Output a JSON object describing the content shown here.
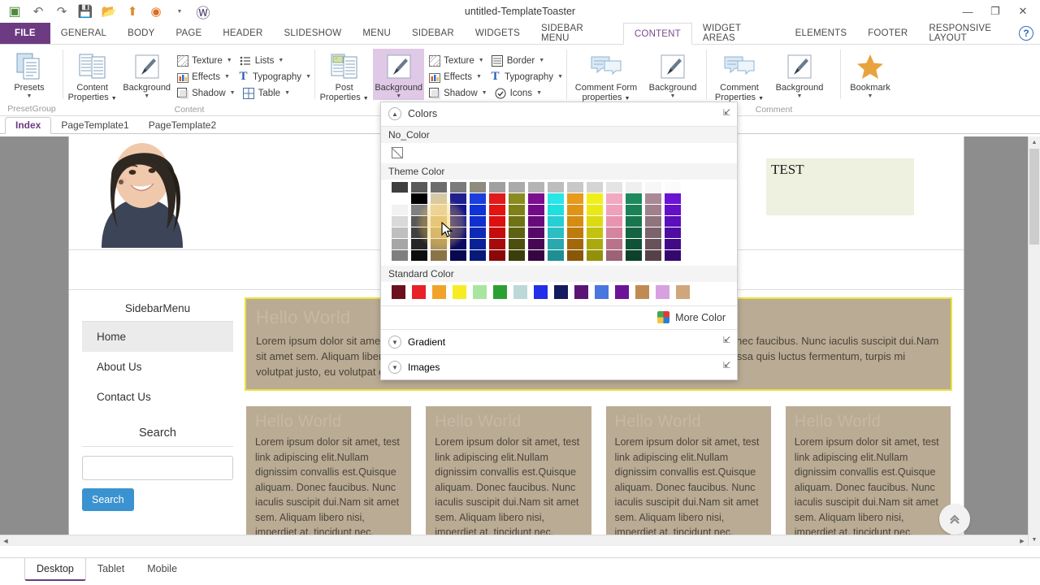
{
  "window": {
    "title": "untitled-TemplateToaster",
    "minimize": "—",
    "restore": "❐",
    "close": "✕",
    "help": "?"
  },
  "quick_access": [
    {
      "name": "app-logo-icon",
      "glyph": "▣"
    },
    {
      "name": "undo-icon",
      "glyph": "↶"
    },
    {
      "name": "redo-icon",
      "glyph": "↷"
    },
    {
      "name": "save-icon",
      "glyph": "ὋE"
    },
    {
      "name": "open-icon",
      "glyph": "Ὄ2"
    },
    {
      "name": "export-icon",
      "glyph": "⬆"
    },
    {
      "name": "browser-preview-icon",
      "glyph": "◉"
    },
    {
      "name": "wordpress-icon",
      "glyph": "Ⓦ"
    }
  ],
  "ribbon_tabs": [
    {
      "label": "FILE",
      "state": "file"
    },
    {
      "label": "GENERAL",
      "state": "normal"
    },
    {
      "label": "BODY",
      "state": "normal"
    },
    {
      "label": "PAGE",
      "state": "normal"
    },
    {
      "label": "HEADER",
      "state": "normal"
    },
    {
      "label": "SLIDESHOW",
      "state": "normal"
    },
    {
      "label": "MENU",
      "state": "normal"
    },
    {
      "label": "SIDEBAR",
      "state": "normal"
    },
    {
      "label": "WIDGETS",
      "state": "normal"
    },
    {
      "label": "SIDEBAR MENU",
      "state": "normal"
    },
    {
      "label": "CONTENT",
      "state": "active"
    },
    {
      "label": "WIDGET AREAS",
      "state": "normal"
    },
    {
      "label": "ELEMENTS",
      "state": "normal"
    },
    {
      "label": "FOOTER",
      "state": "normal"
    },
    {
      "label": "RESPONSIVE LAYOUT",
      "state": "normal"
    }
  ],
  "ribbon": {
    "groups": [
      {
        "label": "PresetGroup",
        "big": [
          {
            "label": "Presets",
            "icon": "presets-icon",
            "caret": true,
            "selected": false
          }
        ],
        "small": []
      },
      {
        "label": "Content",
        "big": [
          {
            "label": "Content\nProperties",
            "icon": "content-properties-icon",
            "caret": true,
            "selected": false
          },
          {
            "label": "Background",
            "icon": "background-brush-icon",
            "caret": true,
            "selected": false
          }
        ],
        "small": [
          {
            "label": "Texture",
            "icon": "texture-icon",
            "caret": true
          },
          {
            "label": "Lists",
            "icon": "lists-icon",
            "caret": true
          },
          {
            "label": "Effects",
            "icon": "effects-icon",
            "caret": true
          },
          {
            "label": "Typography",
            "icon": "typography-icon",
            "caret": true
          },
          {
            "label": "Shadow",
            "icon": "shadow-icon",
            "caret": true
          },
          {
            "label": "Table",
            "icon": "table-icon",
            "caret": true
          }
        ]
      },
      {
        "label": "",
        "big": [
          {
            "label": "Post\nProperties",
            "icon": "post-properties-icon",
            "caret": true,
            "selected": false
          },
          {
            "label": "Background",
            "icon": "background-brush-icon",
            "caret": true,
            "selected": true
          }
        ],
        "small": [
          {
            "label": "Texture",
            "icon": "texture-icon",
            "caret": true
          },
          {
            "label": "Border",
            "icon": "border-icon",
            "caret": true
          },
          {
            "label": "Effects",
            "icon": "effects-icon",
            "caret": true
          },
          {
            "label": "Typography",
            "icon": "typography-icon",
            "caret": true
          },
          {
            "label": "Shadow",
            "icon": "shadow-icon",
            "caret": true
          },
          {
            "label": "Icons",
            "icon": "icons-icon",
            "caret": true
          }
        ]
      },
      {
        "label": "",
        "big": [
          {
            "label": "Comment Form\nproperties",
            "icon": "comment-form-icon",
            "caret": true,
            "selected": false
          },
          {
            "label": "Background",
            "icon": "background-brush-icon",
            "caret": true,
            "selected": false
          }
        ],
        "small": []
      },
      {
        "label": "Comment",
        "big": [
          {
            "label": "Comment\nProperties",
            "icon": "comment-icon",
            "caret": true,
            "selected": false
          },
          {
            "label": "Background",
            "icon": "background-brush-icon",
            "caret": true,
            "selected": false
          }
        ],
        "small": []
      },
      {
        "label": "",
        "big": [
          {
            "label": "Bookmark",
            "icon": "bookmark-star-icon",
            "caret": true,
            "selected": false
          }
        ],
        "small": []
      }
    ]
  },
  "page_tabs": [
    {
      "label": "Index",
      "active": true
    },
    {
      "label": "PageTemplate1",
      "active": false
    },
    {
      "label": "PageTemplate2",
      "active": false
    }
  ],
  "color_panel": {
    "header": "Colors",
    "no_color_label": "No_Color",
    "theme_color_label": "Theme Color",
    "standard_color_label": "Standard Color",
    "more_color_label": "More Color",
    "gradient_label": "Gradient",
    "images_label": "Images",
    "theme_columns": [
      [
        "#3f3f3f",
        "#ffffff",
        "#f2f2f2",
        "#d9d9d9",
        "#bfbfbf",
        "#a6a6a6",
        "#7f7f7f"
      ],
      [
        "#5a5a5a",
        "#000000",
        "#808080",
        "#595959",
        "#404040",
        "#262626",
        "#0d0d0d"
      ],
      [
        "#6d6d6d",
        "#d8c9a6",
        "#e8d9b8",
        "#d9c69a",
        "#c4ad7c",
        "#a8905f",
        "#8a7347"
      ],
      [
        "#7b7b7b",
        "#1f1f8f",
        "#13138c",
        "#16168f",
        "#101077",
        "#0b0b63",
        "#08084f"
      ],
      [
        "#8f8c7d",
        "#1a3fdc",
        "#1033d8",
        "#0f30cf",
        "#0d2ab4",
        "#0a2296",
        "#071a78"
      ],
      [
        "#a0a0a0",
        "#e01b1b",
        "#e31414",
        "#dc1010",
        "#c40d0d",
        "#a60b0b",
        "#8a0808"
      ],
      [
        "#aaaaaa",
        "#8a8c20",
        "#7f8118",
        "#6f7314",
        "#5d6111",
        "#4c4f0d",
        "#3b3d0a"
      ],
      [
        "#b4b4b4",
        "#7b0f8f",
        "#730b88",
        "#680a7c",
        "#570968",
        "#470754",
        "#370541"
      ],
      [
        "#bdbdbd",
        "#2ae6e6",
        "#1fe0e0",
        "#25cfd4",
        "#2bbfc4",
        "#29a8ad",
        "#1f8f94"
      ],
      [
        "#c8c8c8",
        "#e79a1c",
        "#e09416",
        "#d68c12",
        "#bd7a0f",
        "#a3680c",
        "#8a5709"
      ],
      [
        "#d4d4d4",
        "#f0ef1b",
        "#ebe915",
        "#dcda13",
        "#c4c210",
        "#abaa0d",
        "#93910a"
      ],
      [
        "#e4e4e4",
        "#f2a8c0",
        "#efa0ba",
        "#e894b0",
        "#d4849f",
        "#b8738b",
        "#9c6276"
      ],
      [
        "#efefef",
        "#1f8a5e",
        "#1b8257",
        "#18764e",
        "#146343",
        "#105237",
        "#0d412c"
      ],
      [
        "#f7f7f7",
        "#a98a94",
        "#a0818b",
        "#8f737d",
        "#7c626b",
        "#685159",
        "#554147"
      ],
      [
        "#fbfbfb",
        "#6b14d4",
        "#6410c9",
        "#5b0ebb",
        "#4e0ca0",
        "#420a87",
        "#35086d"
      ]
    ],
    "standard_colors": [
      "#6b1020",
      "#e8202a",
      "#efa429",
      "#f7ec23",
      "#a8e6a0",
      "#2ba032",
      "#bcd9d9",
      "#2030e8",
      "#141b5e",
      "#5b1475",
      "#4a76dd",
      "#6b1499",
      "#c08b52",
      "#d9a0e0",
      "#cfa77a"
    ]
  },
  "preview": {
    "test_box_text": "TEST",
    "sidebar": {
      "title": "SidebarMenu",
      "items": [
        {
          "label": "Home",
          "active": true
        },
        {
          "label": "About Us",
          "active": false
        },
        {
          "label": "Contact Us",
          "active": false
        }
      ],
      "search_title": "Search",
      "search_value": "",
      "search_button": "Search"
    },
    "main_block": {
      "heading": "Hello World",
      "body": "Lorem ipsum dolor sit amet, test link adipiscing elit.Nullam dignissim convallis est.Quisque aliquam. Donec faucibus. Nunc iaculis suscipit dui.Nam sit amet sem. Aliquam libero nisi, imperdiet at, tincidunt nec, gravida vehicula, nisl. Praesent mattis, massa quis luctus fermentum, turpis mi volutpat justo, eu volutpat enim diam eget metus.Maecenas ornare tortor."
    },
    "columns": [
      {
        "heading": "Hello World",
        "body": "Lorem ipsum dolor sit amet, test link adipiscing elit.Nullam dignissim convallis est.Quisque aliquam. Donec faucibus. Nunc iaculis suscipit dui.Nam sit amet sem. Aliquam libero nisi, imperdiet at, tincidunt nec,"
      },
      {
        "heading": "Hello World",
        "body": "Lorem ipsum dolor sit amet, test link adipiscing elit.Nullam dignissim convallis est.Quisque aliquam. Donec faucibus. Nunc iaculis suscipit dui.Nam sit amet sem. Aliquam libero nisi, imperdiet at, tincidunt nec,"
      },
      {
        "heading": "Hello World",
        "body": "Lorem ipsum dolor sit amet, test link adipiscing elit.Nullam dignissim convallis est.Quisque aliquam. Donec faucibus. Nunc iaculis suscipit dui.Nam sit amet sem. Aliquam libero nisi, imperdiet at, tincidunt nec,"
      },
      {
        "heading": "Hello World",
        "body": "Lorem ipsum dolor sit amet, test link adipiscing elit.Nullam dignissim convallis est.Quisque aliquam. Donec faucibus. Nunc iaculis suscipit dui.Nam sit amet sem. Aliquam libero nisi, imperdiet at, tincidunt nec,"
      }
    ],
    "scroll_top_icon": "«"
  },
  "device_tabs": [
    {
      "label": "Desktop",
      "active": true
    },
    {
      "label": "Tablet",
      "active": false
    },
    {
      "label": "Mobile",
      "active": false
    }
  ],
  "colors": {
    "accent_purple": "#6c3b81",
    "selection_yellow": "#ece13f",
    "block_bg": "#b9ab94",
    "search_button": "#3b92d0"
  }
}
